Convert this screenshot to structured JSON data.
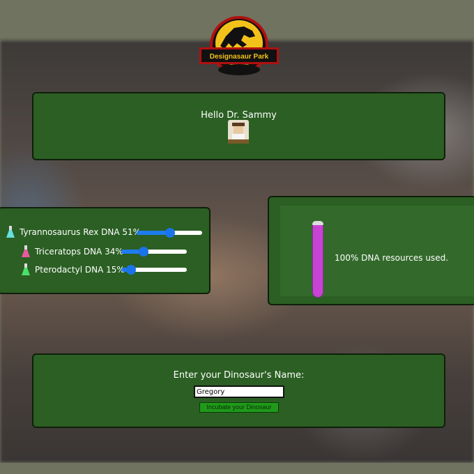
{
  "logo": {
    "text": "Designasaur Park",
    "icon": "t-rex-skeleton-icon"
  },
  "greeting": {
    "text": "Hello Dr. Sammy",
    "avatar_icon": "scientist-avatar-icon"
  },
  "dna": {
    "items": [
      {
        "label": "Tyrannosaurus Rex DNA 51%",
        "value": 51,
        "flask_color": "#66e0e0",
        "icon": "flask-icon"
      },
      {
        "label": "Triceratops DNA 34%",
        "value": 34,
        "flask_color": "#e85aa0",
        "icon": "flask-icon"
      },
      {
        "label": "Pterodactyl DNA 15%",
        "value": 15,
        "flask_color": "#4be06a",
        "icon": "flask-icon"
      }
    ],
    "accent": "#1a73e8"
  },
  "resources": {
    "text": "100% DNA resources used.",
    "fill_percent": 100,
    "tube_color": "#c843d4"
  },
  "naming": {
    "label": "Enter your Dinosaur's Name:",
    "input_value": "Gregory",
    "button_label": "Incubate your Dinosaur"
  }
}
